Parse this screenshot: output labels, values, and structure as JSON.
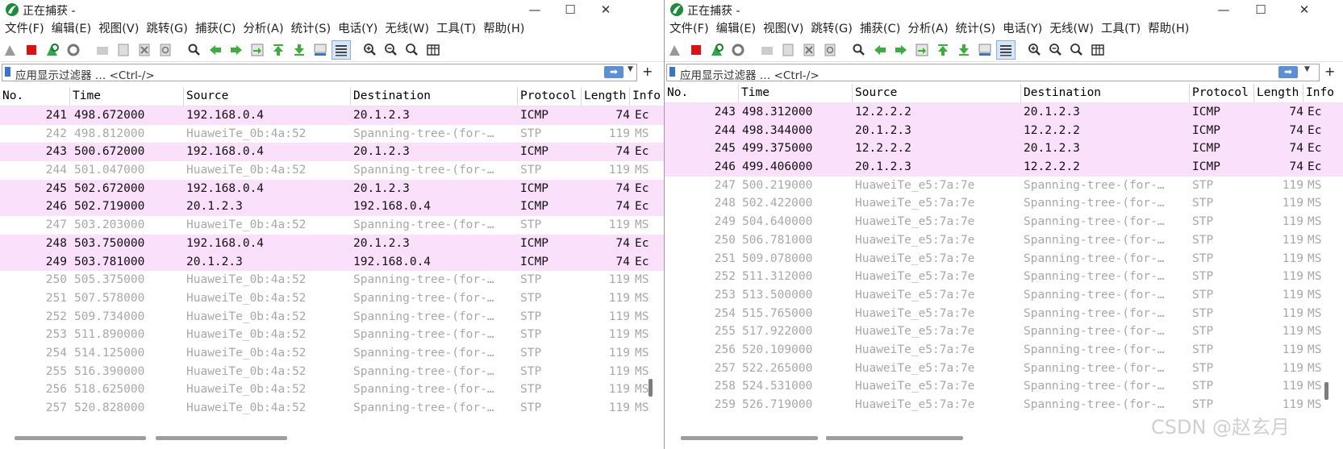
{
  "colors": {
    "icmp_row": "#fbe0fb",
    "stp_row": "#ffffff",
    "stp_text": "#a8a8a8"
  },
  "windows": [
    {
      "title": "正在捕获 -",
      "menu": [
        "文件(F)",
        "编辑(E)",
        "视图(V)",
        "跳转(G)",
        "捕获(C)",
        "分析(A)",
        "统计(S)",
        "电话(Y)",
        "无线(W)",
        "工具(T)",
        "帮助(H)"
      ],
      "filter_placeholder": "应用显示过滤器 … <Ctrl-/>",
      "columns": [
        "No.",
        "Time",
        "Source",
        "Destination",
        "Protocol",
        "Length",
        "Info"
      ],
      "packets": [
        {
          "no": "241",
          "time": "498.672000",
          "source": "192.168.0.4",
          "destination": "20.1.2.3",
          "protocol": "ICMP",
          "length": "74",
          "info": "Ec",
          "kind": "icmp"
        },
        {
          "no": "242",
          "time": "498.812000",
          "source": "HuaweiTe_0b:4a:52",
          "destination": "Spanning-tree-(for-…",
          "protocol": "STP",
          "length": "119",
          "info": "MS",
          "kind": "stp"
        },
        {
          "no": "243",
          "time": "500.672000",
          "source": "192.168.0.4",
          "destination": "20.1.2.3",
          "protocol": "ICMP",
          "length": "74",
          "info": "Ec",
          "kind": "icmp"
        },
        {
          "no": "244",
          "time": "501.047000",
          "source": "HuaweiTe_0b:4a:52",
          "destination": "Spanning-tree-(for-…",
          "protocol": "STP",
          "length": "119",
          "info": "MS",
          "kind": "stp"
        },
        {
          "no": "245",
          "time": "502.672000",
          "source": "192.168.0.4",
          "destination": "20.1.2.3",
          "protocol": "ICMP",
          "length": "74",
          "info": "Ec",
          "kind": "icmp"
        },
        {
          "no": "246",
          "time": "502.719000",
          "source": "20.1.2.3",
          "destination": "192.168.0.4",
          "protocol": "ICMP",
          "length": "74",
          "info": "Ec",
          "kind": "icmp"
        },
        {
          "no": "247",
          "time": "503.203000",
          "source": "HuaweiTe_0b:4a:52",
          "destination": "Spanning-tree-(for-…",
          "protocol": "STP",
          "length": "119",
          "info": "MS",
          "kind": "stp"
        },
        {
          "no": "248",
          "time": "503.750000",
          "source": "192.168.0.4",
          "destination": "20.1.2.3",
          "protocol": "ICMP",
          "length": "74",
          "info": "Ec",
          "kind": "icmp"
        },
        {
          "no": "249",
          "time": "503.781000",
          "source": "20.1.2.3",
          "destination": "192.168.0.4",
          "protocol": "ICMP",
          "length": "74",
          "info": "Ec",
          "kind": "icmp"
        },
        {
          "no": "250",
          "time": "505.375000",
          "source": "HuaweiTe_0b:4a:52",
          "destination": "Spanning-tree-(for-…",
          "protocol": "STP",
          "length": "119",
          "info": "MS",
          "kind": "stp"
        },
        {
          "no": "251",
          "time": "507.578000",
          "source": "HuaweiTe_0b:4a:52",
          "destination": "Spanning-tree-(for-…",
          "protocol": "STP",
          "length": "119",
          "info": "MS",
          "kind": "stp"
        },
        {
          "no": "252",
          "time": "509.734000",
          "source": "HuaweiTe_0b:4a:52",
          "destination": "Spanning-tree-(for-…",
          "protocol": "STP",
          "length": "119",
          "info": "MS",
          "kind": "stp"
        },
        {
          "no": "253",
          "time": "511.890000",
          "source": "HuaweiTe_0b:4a:52",
          "destination": "Spanning-tree-(for-…",
          "protocol": "STP",
          "length": "119",
          "info": "MS",
          "kind": "stp"
        },
        {
          "no": "254",
          "time": "514.125000",
          "source": "HuaweiTe_0b:4a:52",
          "destination": "Spanning-tree-(for-…",
          "protocol": "STP",
          "length": "119",
          "info": "MS",
          "kind": "stp"
        },
        {
          "no": "255",
          "time": "516.390000",
          "source": "HuaweiTe_0b:4a:52",
          "destination": "Spanning-tree-(for-…",
          "protocol": "STP",
          "length": "119",
          "info": "MS",
          "kind": "stp"
        },
        {
          "no": "256",
          "time": "518.625000",
          "source": "HuaweiTe_0b:4a:52",
          "destination": "Spanning-tree-(for-…",
          "protocol": "STP",
          "length": "119",
          "info": "MS",
          "kind": "stp"
        },
        {
          "no": "257",
          "time": "520.828000",
          "source": "HuaweiTe_0b:4a:52",
          "destination": "Spanning-tree-(for-…",
          "protocol": "STP",
          "length": "119",
          "info": "MS",
          "kind": "stp"
        }
      ]
    },
    {
      "title": "正在捕获 -",
      "menu": [
        "文件(F)",
        "编辑(E)",
        "视图(V)",
        "跳转(G)",
        "捕获(C)",
        "分析(A)",
        "统计(S)",
        "电话(Y)",
        "无线(W)",
        "工具(T)",
        "帮助(H)"
      ],
      "filter_placeholder": "应用显示过滤器 … <Ctrl-/>",
      "columns": [
        "No.",
        "Time",
        "Source",
        "Destination",
        "Protocol",
        "Length",
        "Info"
      ],
      "packets": [
        {
          "no": "243",
          "time": "498.312000",
          "source": "12.2.2.2",
          "destination": "20.1.2.3",
          "protocol": "ICMP",
          "length": "74",
          "info": "Ec",
          "kind": "icmp"
        },
        {
          "no": "244",
          "time": "498.344000",
          "source": "20.1.2.3",
          "destination": "12.2.2.2",
          "protocol": "ICMP",
          "length": "74",
          "info": "Ec",
          "kind": "icmp"
        },
        {
          "no": "245",
          "time": "499.375000",
          "source": "12.2.2.2",
          "destination": "20.1.2.3",
          "protocol": "ICMP",
          "length": "74",
          "info": "Ec",
          "kind": "icmp"
        },
        {
          "no": "246",
          "time": "499.406000",
          "source": "20.1.2.3",
          "destination": "12.2.2.2",
          "protocol": "ICMP",
          "length": "74",
          "info": "Ec",
          "kind": "icmp"
        },
        {
          "no": "247",
          "time": "500.219000",
          "source": "HuaweiTe_e5:7a:7e",
          "destination": "Spanning-tree-(for-…",
          "protocol": "STP",
          "length": "119",
          "info": "MS",
          "kind": "stp"
        },
        {
          "no": "248",
          "time": "502.422000",
          "source": "HuaweiTe_e5:7a:7e",
          "destination": "Spanning-tree-(for-…",
          "protocol": "STP",
          "length": "119",
          "info": "MS",
          "kind": "stp"
        },
        {
          "no": "249",
          "time": "504.640000",
          "source": "HuaweiTe_e5:7a:7e",
          "destination": "Spanning-tree-(for-…",
          "protocol": "STP",
          "length": "119",
          "info": "MS",
          "kind": "stp"
        },
        {
          "no": "250",
          "time": "506.781000",
          "source": "HuaweiTe_e5:7a:7e",
          "destination": "Spanning-tree-(for-…",
          "protocol": "STP",
          "length": "119",
          "info": "MS",
          "kind": "stp"
        },
        {
          "no": "251",
          "time": "509.078000",
          "source": "HuaweiTe_e5:7a:7e",
          "destination": "Spanning-tree-(for-…",
          "protocol": "STP",
          "length": "119",
          "info": "MS",
          "kind": "stp"
        },
        {
          "no": "252",
          "time": "511.312000",
          "source": "HuaweiTe_e5:7a:7e",
          "destination": "Spanning-tree-(for-…",
          "protocol": "STP",
          "length": "119",
          "info": "MS",
          "kind": "stp"
        },
        {
          "no": "253",
          "time": "513.500000",
          "source": "HuaweiTe_e5:7a:7e",
          "destination": "Spanning-tree-(for-…",
          "protocol": "STP",
          "length": "119",
          "info": "MS",
          "kind": "stp"
        },
        {
          "no": "254",
          "time": "515.765000",
          "source": "HuaweiTe_e5:7a:7e",
          "destination": "Spanning-tree-(for-…",
          "protocol": "STP",
          "length": "119",
          "info": "MS",
          "kind": "stp"
        },
        {
          "no": "255",
          "time": "517.922000",
          "source": "HuaweiTe_e5:7a:7e",
          "destination": "Spanning-tree-(for-…",
          "protocol": "STP",
          "length": "119",
          "info": "MS",
          "kind": "stp"
        },
        {
          "no": "256",
          "time": "520.109000",
          "source": "HuaweiTe_e5:7a:7e",
          "destination": "Spanning-tree-(for-…",
          "protocol": "STP",
          "length": "119",
          "info": "MS",
          "kind": "stp"
        },
        {
          "no": "257",
          "time": "522.265000",
          "source": "HuaweiTe_e5:7a:7e",
          "destination": "Spanning-tree-(for-…",
          "protocol": "STP",
          "length": "119",
          "info": "MS",
          "kind": "stp"
        },
        {
          "no": "258",
          "time": "524.531000",
          "source": "HuaweiTe_e5:7a:7e",
          "destination": "Spanning-tree-(for-…",
          "protocol": "STP",
          "length": "119",
          "info": "MS",
          "kind": "stp"
        },
        {
          "no": "259",
          "time": "526.719000",
          "source": "HuaweiTe_e5:7a:7e",
          "destination": "Spanning-tree-(for-…",
          "protocol": "STP",
          "length": "119",
          "info": "MS",
          "kind": "stp"
        }
      ]
    }
  ],
  "watermark": "CSDN @赵玄月",
  "toolbar_icons": [
    "shark-fin-start-icon",
    "stop-capture-icon",
    "restart-capture-icon",
    "capture-options-icon",
    "open-file-icon",
    "save-file-icon",
    "close-file-icon",
    "reload-file-icon",
    "find-packet-icon",
    "go-back-icon",
    "go-forward-icon",
    "go-to-packet-icon",
    "first-packet-icon",
    "last-packet-icon",
    "autoscroll-icon",
    "colorize-icon",
    "zoom-in-icon",
    "zoom-out-icon",
    "normal-size-icon",
    "resize-columns-icon"
  ]
}
